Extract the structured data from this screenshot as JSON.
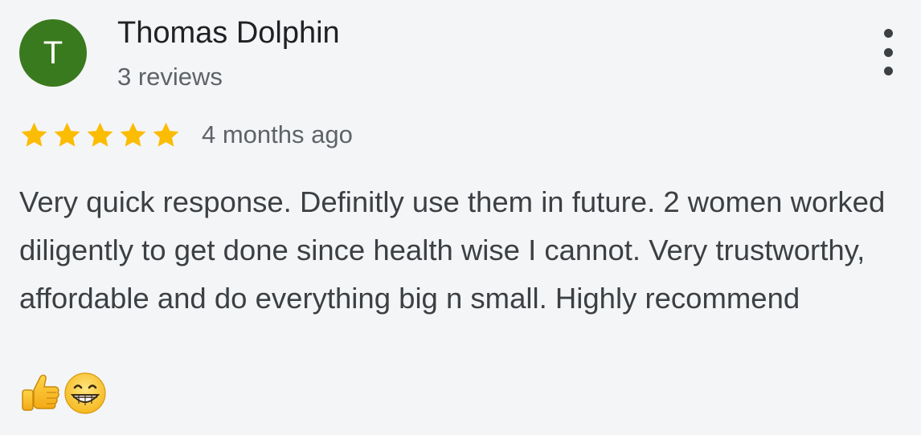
{
  "reviewer": {
    "initial": "T",
    "name": "Thomas Dolphin",
    "reviews_count": "3 reviews",
    "avatar_color": "#3a7a1e"
  },
  "menu": {
    "icon": "more-vert-icon"
  },
  "rating": {
    "value": 5,
    "max": 5,
    "star_color": "#fbbc04",
    "time": "4 months ago"
  },
  "review": {
    "text": "Very quick response. Definitly use them in future. 2 women worked diligently to get done since health wise I cannot. Very trustworthy, affordable and do everything big n small. Highly recommend",
    "emojis": [
      "thumbs-up-emoji",
      "grinning-face-emoji"
    ]
  }
}
